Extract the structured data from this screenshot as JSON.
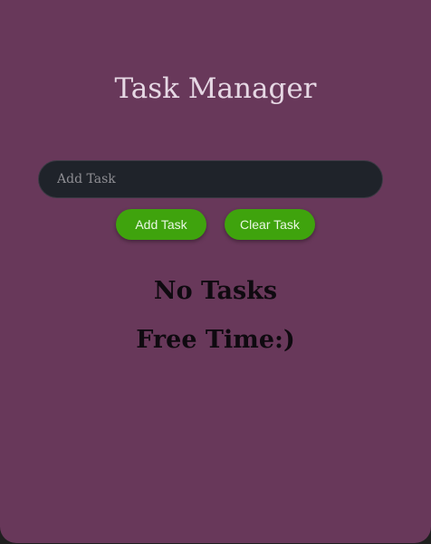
{
  "app": {
    "title": "Task Manager"
  },
  "input": {
    "placeholder": "Add Task",
    "value": ""
  },
  "buttons": {
    "add_label": "Add Task",
    "clear_label": "Clear Task"
  },
  "empty_state": {
    "line1": "No Tasks",
    "line2": "Free Time:)"
  },
  "colors": {
    "background": "#68385a",
    "input_bg": "#1f232a",
    "button_bg": "#3fa30d"
  }
}
